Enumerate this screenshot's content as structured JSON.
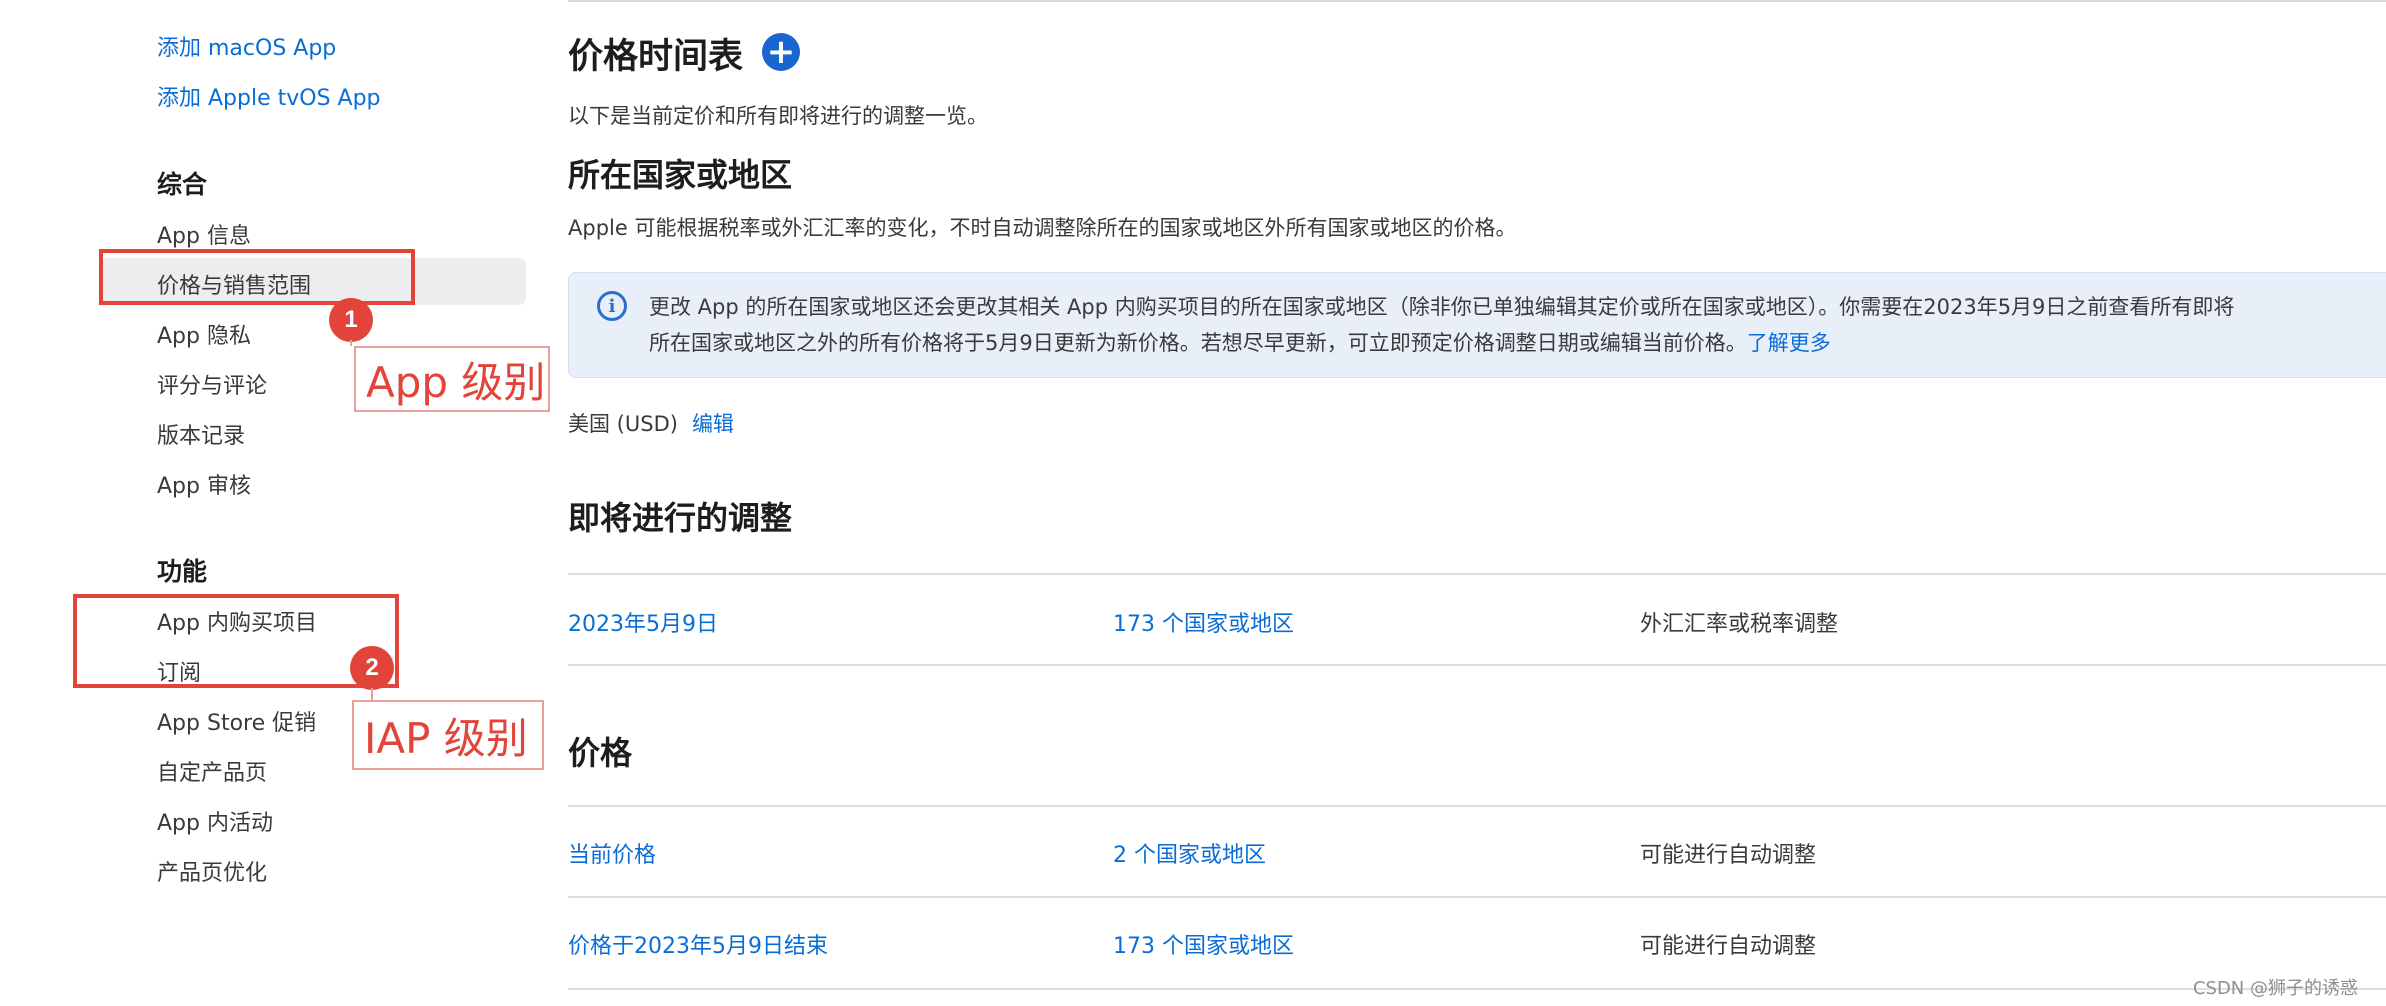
{
  "sidebar": {
    "add_macos": "添加 macOS App",
    "add_tvos": "添加 Apple tvOS App",
    "general_heading": "综合",
    "general_items": [
      "App 信息",
      "价格与销售范围",
      "App 隐私",
      "评分与评论",
      "版本记录",
      "App 审核"
    ],
    "features_heading": "功能",
    "feature_items": [
      "App 内购买项目",
      "订阅",
      "App Store 促销",
      "自定产品页",
      "App 内活动",
      "产品页优化"
    ]
  },
  "annotations": {
    "badge1": "1",
    "label1": "App 级别",
    "badge2": "2",
    "label2": "IAP 级别",
    "color": "#e2443a"
  },
  "main": {
    "pricing_title": "价格时间表",
    "add_icon": "plus-circle-icon",
    "pricing_desc": "以下是当前定价和所有即将进行的调整一览。",
    "region_title": "所在国家或地区",
    "region_desc": "Apple 可能根据税率或外汇汇率的变化，不时自动调整除所在的国家或地区外所有国家或地区的价格。",
    "info": {
      "icon": "info-circle-icon",
      "line1": "更改 App 的所在国家或地区还会更改其相关 App 内购买项目的所在国家或地区（除非你已单独编辑其定价或所在国家或地区）。你需要在2023年5月9日之前查看所有即将",
      "line2": "所在国家或地区之外的所有价格将于5月9日更新为新价格。若想尽早更新，可立即预定价格调整日期或编辑当前价格。",
      "link": "了解更多"
    },
    "current_region": "美国 (USD)",
    "edit_label": "编辑",
    "upcoming_title": "即将进行的调整",
    "upcoming_rows": [
      {
        "date": "2023年5月9日",
        "regions": "173 个国家或地区",
        "note": "外汇汇率或税率调整"
      }
    ],
    "prices_title": "价格",
    "price_rows": [
      {
        "name": "当前价格",
        "regions": "2 个国家或地区",
        "note": "可能进行自动调整"
      },
      {
        "name": "价格于2023年5月9日结束",
        "regions": "173 个国家或地区",
        "note": "可能进行自动调整"
      }
    ]
  },
  "watermark": "CSDN @狮子的诱惑",
  "colors": {
    "link": "#0a6dd6",
    "accent": "#1a66d0",
    "annotation": "#e2443a"
  }
}
